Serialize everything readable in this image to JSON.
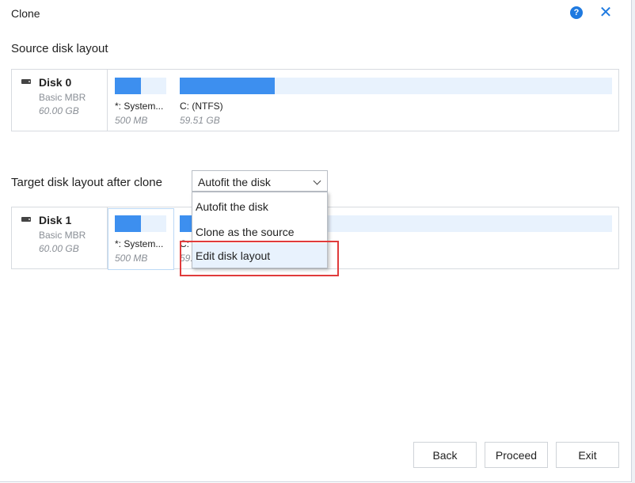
{
  "window": {
    "title": "Clone"
  },
  "icons": {
    "help": "help-circle-icon",
    "close": "close-icon",
    "disk": "hard-disk-icon"
  },
  "colors": {
    "accent": "#1f7ae0",
    "partition_fill": "#3d8fef",
    "partition_bg": "#e8f2fd",
    "highlight": "#e03b3b"
  },
  "source": {
    "heading": "Source disk layout",
    "disk": {
      "name": "Disk 0",
      "type": "Basic MBR",
      "size": "60.00 GB"
    },
    "partitions": [
      {
        "label": "*: System...",
        "size": "500 MB",
        "used_fraction": 0.5
      },
      {
        "label": "C:  (NTFS)",
        "size": "59.51 GB",
        "used_fraction": 0.22
      }
    ]
  },
  "target": {
    "heading": "Target disk layout after clone",
    "disk": {
      "name": "Disk 1",
      "type": "Basic MBR",
      "size": "60.00 GB"
    },
    "partitions": [
      {
        "label": "*: System...",
        "size": "500 MB",
        "used_fraction": 0.5
      },
      {
        "label": "C:",
        "size": "59.",
        "used_fraction": 0.2
      }
    ]
  },
  "layout_select": {
    "value": "Autofit the disk",
    "options": [
      "Autofit the disk",
      "Clone as the source",
      "Edit disk layout"
    ],
    "hovered_index": 2
  },
  "buttons": {
    "back": "Back",
    "proceed": "Proceed",
    "exit": "Exit"
  }
}
